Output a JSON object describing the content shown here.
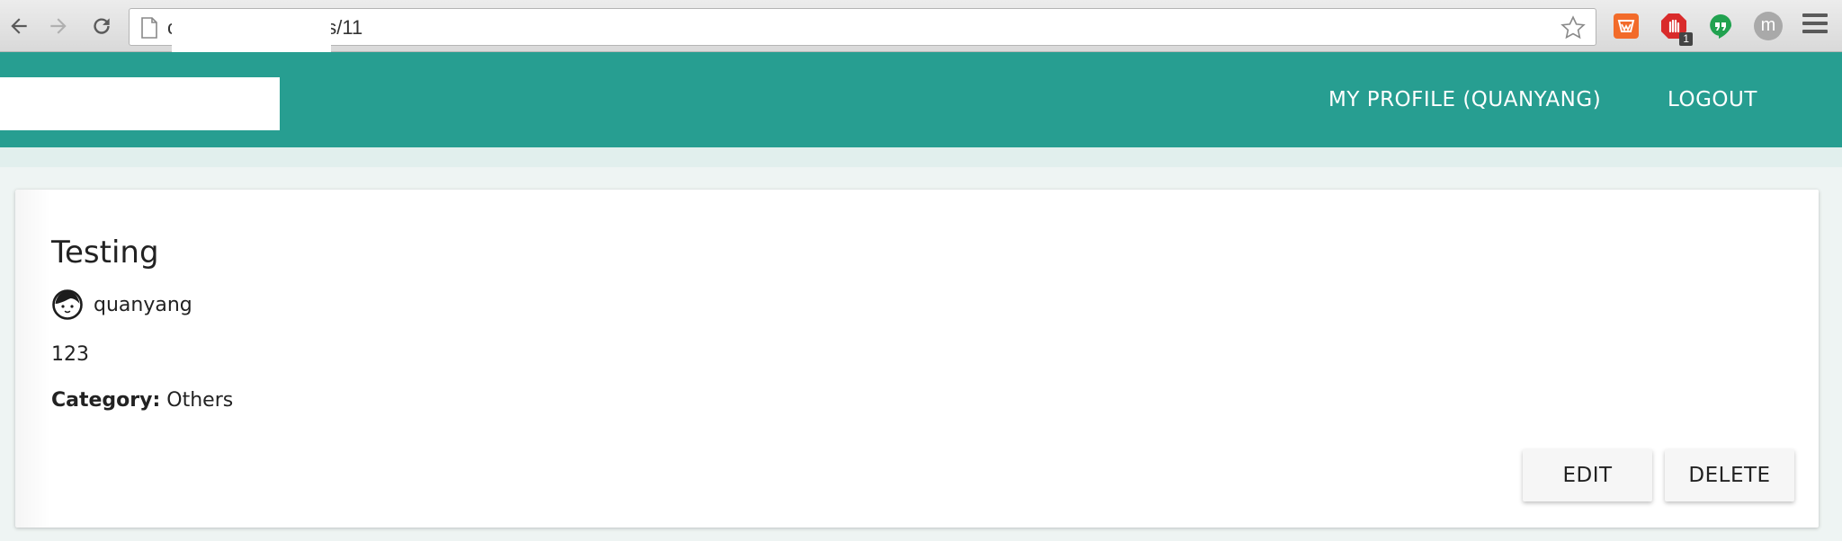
{
  "browser": {
    "url_visible": "c                 /listings/11",
    "url_path": "/listings/11",
    "url_first_char": "c"
  },
  "appbar": {
    "profile_label": "MY PROFILE (QUANYANG)",
    "logout_label": "LOGOUT",
    "accent_color": "#279e91"
  },
  "listing": {
    "title": "Testing",
    "username": "quanyang",
    "description": "123",
    "category_label": "Category:",
    "category_value": "Others"
  },
  "actions": {
    "edit_label": "EDIT",
    "delete_label": "DELETE"
  },
  "extensions": {
    "avatar_letter": "m",
    "badge_count": "1"
  }
}
